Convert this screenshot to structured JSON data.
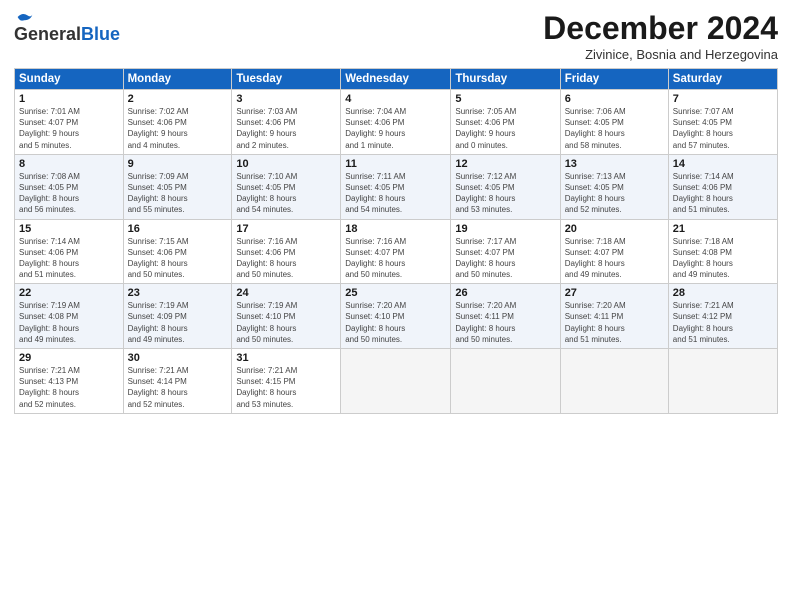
{
  "header": {
    "logo_general": "General",
    "logo_blue": "Blue",
    "month_title": "December 2024",
    "subtitle": "Zivinice, Bosnia and Herzegovina"
  },
  "days_of_week": [
    "Sunday",
    "Monday",
    "Tuesday",
    "Wednesday",
    "Thursday",
    "Friday",
    "Saturday"
  ],
  "weeks": [
    [
      {
        "day": 1,
        "sunrise": "7:01 AM",
        "sunset": "4:07 PM",
        "daylight": "9 hours and 5 minutes."
      },
      {
        "day": 2,
        "sunrise": "7:02 AM",
        "sunset": "4:06 PM",
        "daylight": "9 hours and 4 minutes."
      },
      {
        "day": 3,
        "sunrise": "7:03 AM",
        "sunset": "4:06 PM",
        "daylight": "9 hours and 2 minutes."
      },
      {
        "day": 4,
        "sunrise": "7:04 AM",
        "sunset": "4:06 PM",
        "daylight": "9 hours and 1 minute."
      },
      {
        "day": 5,
        "sunrise": "7:05 AM",
        "sunset": "4:06 PM",
        "daylight": "9 hours and 0 minutes."
      },
      {
        "day": 6,
        "sunrise": "7:06 AM",
        "sunset": "4:05 PM",
        "daylight": "8 hours and 58 minutes."
      },
      {
        "day": 7,
        "sunrise": "7:07 AM",
        "sunset": "4:05 PM",
        "daylight": "8 hours and 57 minutes."
      }
    ],
    [
      {
        "day": 8,
        "sunrise": "7:08 AM",
        "sunset": "4:05 PM",
        "daylight": "8 hours and 56 minutes."
      },
      {
        "day": 9,
        "sunrise": "7:09 AM",
        "sunset": "4:05 PM",
        "daylight": "8 hours and 55 minutes."
      },
      {
        "day": 10,
        "sunrise": "7:10 AM",
        "sunset": "4:05 PM",
        "daylight": "8 hours and 54 minutes."
      },
      {
        "day": 11,
        "sunrise": "7:11 AM",
        "sunset": "4:05 PM",
        "daylight": "8 hours and 54 minutes."
      },
      {
        "day": 12,
        "sunrise": "7:12 AM",
        "sunset": "4:05 PM",
        "daylight": "8 hours and 53 minutes."
      },
      {
        "day": 13,
        "sunrise": "7:13 AM",
        "sunset": "4:05 PM",
        "daylight": "8 hours and 52 minutes."
      },
      {
        "day": 14,
        "sunrise": "7:14 AM",
        "sunset": "4:06 PM",
        "daylight": "8 hours and 51 minutes."
      }
    ],
    [
      {
        "day": 15,
        "sunrise": "7:14 AM",
        "sunset": "4:06 PM",
        "daylight": "8 hours and 51 minutes."
      },
      {
        "day": 16,
        "sunrise": "7:15 AM",
        "sunset": "4:06 PM",
        "daylight": "8 hours and 50 minutes."
      },
      {
        "day": 17,
        "sunrise": "7:16 AM",
        "sunset": "4:06 PM",
        "daylight": "8 hours and 50 minutes."
      },
      {
        "day": 18,
        "sunrise": "7:16 AM",
        "sunset": "4:07 PM",
        "daylight": "8 hours and 50 minutes."
      },
      {
        "day": 19,
        "sunrise": "7:17 AM",
        "sunset": "4:07 PM",
        "daylight": "8 hours and 50 minutes."
      },
      {
        "day": 20,
        "sunrise": "7:18 AM",
        "sunset": "4:07 PM",
        "daylight": "8 hours and 49 minutes."
      },
      {
        "day": 21,
        "sunrise": "7:18 AM",
        "sunset": "4:08 PM",
        "daylight": "8 hours and 49 minutes."
      }
    ],
    [
      {
        "day": 22,
        "sunrise": "7:19 AM",
        "sunset": "4:08 PM",
        "daylight": "8 hours and 49 minutes."
      },
      {
        "day": 23,
        "sunrise": "7:19 AM",
        "sunset": "4:09 PM",
        "daylight": "8 hours and 49 minutes."
      },
      {
        "day": 24,
        "sunrise": "7:19 AM",
        "sunset": "4:10 PM",
        "daylight": "8 hours and 50 minutes."
      },
      {
        "day": 25,
        "sunrise": "7:20 AM",
        "sunset": "4:10 PM",
        "daylight": "8 hours and 50 minutes."
      },
      {
        "day": 26,
        "sunrise": "7:20 AM",
        "sunset": "4:11 PM",
        "daylight": "8 hours and 50 minutes."
      },
      {
        "day": 27,
        "sunrise": "7:20 AM",
        "sunset": "4:11 PM",
        "daylight": "8 hours and 51 minutes."
      },
      {
        "day": 28,
        "sunrise": "7:21 AM",
        "sunset": "4:12 PM",
        "daylight": "8 hours and 51 minutes."
      }
    ],
    [
      {
        "day": 29,
        "sunrise": "7:21 AM",
        "sunset": "4:13 PM",
        "daylight": "8 hours and 52 minutes."
      },
      {
        "day": 30,
        "sunrise": "7:21 AM",
        "sunset": "4:14 PM",
        "daylight": "8 hours and 52 minutes."
      },
      {
        "day": 31,
        "sunrise": "7:21 AM",
        "sunset": "4:15 PM",
        "daylight": "8 hours and 53 minutes."
      },
      null,
      null,
      null,
      null
    ]
  ],
  "labels": {
    "sunrise": "Sunrise:",
    "sunset": "Sunset:",
    "daylight": "Daylight:"
  }
}
